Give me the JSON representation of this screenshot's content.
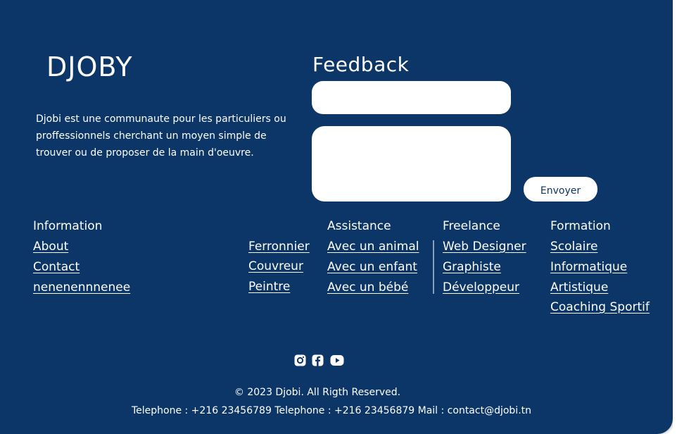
{
  "brand": {
    "name": "DJOBY",
    "description": "Djobi est une communaute pour les particuliers ou proffessionnels cherchant un moyen simple de trouver ou de proposer de la main d'oeuvre."
  },
  "feedback": {
    "title": "Feedback",
    "name_value": "",
    "message_value": "",
    "send_label": "Envoyer"
  },
  "columns": {
    "information": {
      "title": "Information",
      "links": [
        "About",
        "Contact",
        "nenenennnenee"
      ]
    },
    "trades": {
      "links": [
        "Ferronnier",
        "Couvreur",
        "Peintre"
      ]
    },
    "assistance": {
      "title": "Assistance",
      "links": [
        "Avec un animal",
        "Avec un enfant ",
        "Avec un bébé"
      ]
    },
    "freelance": {
      "title": "Freelance",
      "links": [
        "Web Designer",
        "Graphiste",
        "Développeur"
      ]
    },
    "formation": {
      "title": "Formation",
      "links": [
        "Scolaire",
        "Informatique",
        "Artistique",
        "Coaching Sportif"
      ]
    }
  },
  "social": {
    "icons": [
      "instagram-icon",
      "facebook-icon",
      "youtube-icon"
    ]
  },
  "footer": {
    "copyright": "© 2023 Djobi. All Rigth Reserved.",
    "contact": "Telephone : +216 23456789 Telephone : +216 23456879 Mail : contact@djobi.tn"
  },
  "colors": {
    "background": "#0c3667",
    "text": "#ffffff",
    "button_text": "#0c3667"
  }
}
